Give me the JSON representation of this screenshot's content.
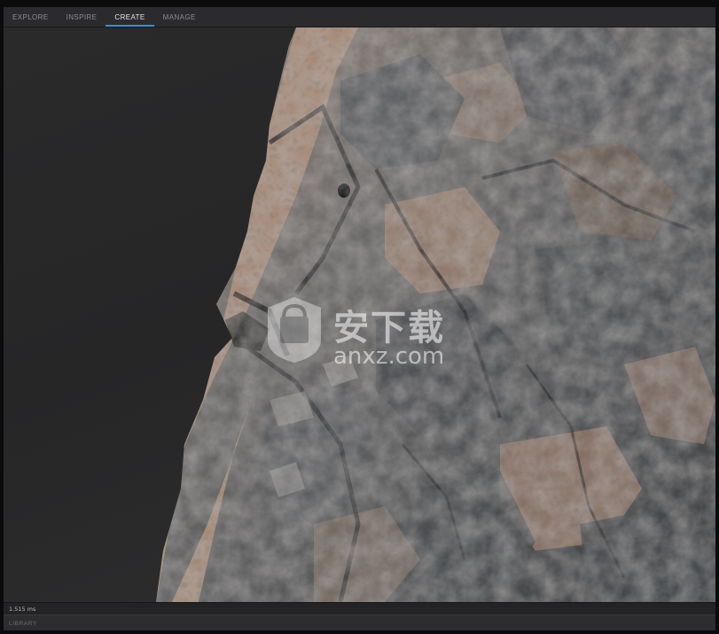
{
  "tabs": [
    {
      "label": "EXPLORE"
    },
    {
      "label": "INSPIRE"
    },
    {
      "label": "CREATE"
    },
    {
      "label": "MANAGE"
    }
  ],
  "active_tab": "CREATE",
  "status": {
    "frame_time": "1.515 ms"
  },
  "library": {
    "label": "LIBRARY"
  },
  "watermark": {
    "text_cn": "安下载",
    "text_en": "anxz.com"
  },
  "colors": {
    "accent": "#3a8dde",
    "rock_gray": "#55585b",
    "rock_sand": "#b08f76",
    "background": "#2a2a2b"
  }
}
